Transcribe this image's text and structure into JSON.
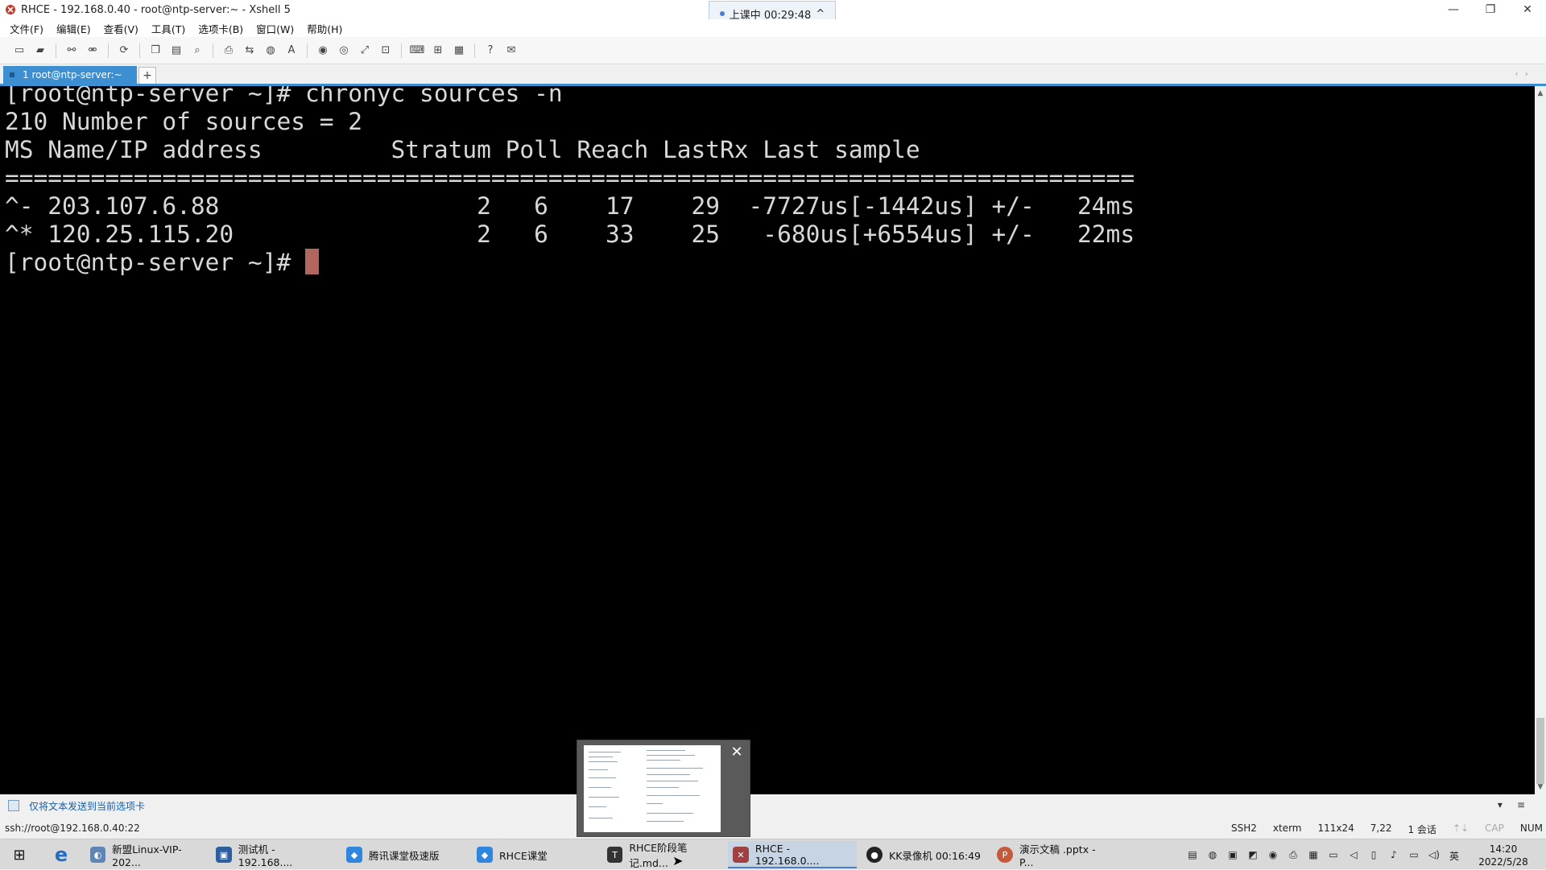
{
  "window": {
    "title": "RHCE - 192.168.0.40 - root@ntp-server:~ - Xshell 5",
    "controls": {
      "minimize": "—",
      "restore": "❐",
      "close": "✕"
    }
  },
  "session_indicator": {
    "label": "上课中 00:29:48",
    "chevron": "^"
  },
  "menu": [
    "文件(F)",
    "编辑(E)",
    "查看(V)",
    "工具(T)",
    "选项卡(B)",
    "窗口(W)",
    "帮助(H)"
  ],
  "toolbar": {
    "icons": [
      "new-session-icon",
      "open-folder-icon",
      "connect-icon",
      "disconnect-icon",
      "reconnect-icon",
      "copy-icon",
      "paste-icon",
      "find-icon",
      "print-icon",
      "transfer-icon",
      "globe-icon",
      "font-icon",
      "xftp-icon",
      "xmanager-icon",
      "fullscreen-icon",
      "lock-icon",
      "keyboard-icon",
      "add-pane-icon",
      "layout-icon",
      "help-icon",
      "chat-icon"
    ]
  },
  "tabs": [
    {
      "label": "1 root@ntp-server:~"
    }
  ],
  "tab_add_label": "+",
  "terminal": {
    "lines": [
      "[root@ntp-server ~]# chronyc sources -n",
      "210 Number of sources = 2",
      "MS Name/IP address         Stratum Poll Reach LastRx Last sample",
      "===============================================================================",
      "^- 203.107.6.88                  2   6    17    29  -7727us[-1442us] +/-   24ms",
      "^* 120.25.115.20                 2   6    33    25   -680us[+6554us] +/-   22ms",
      "[root@ntp-server ~]# "
    ],
    "background": "#000000",
    "foreground": "#d8d8d8",
    "cursor_color": "#b3665e"
  },
  "send_bar": {
    "label": "仅将文本发送到当前选项卡"
  },
  "status": {
    "connection": "ssh://root@192.168.0.40:22",
    "protocol": "SSH2",
    "terminal_type": "xterm",
    "size": "111x24",
    "cursor_pos": "7,22",
    "sessions": "1 会话",
    "caps": "CAP",
    "num": "NUM"
  },
  "taskbar": {
    "items": [
      {
        "label": "新盟Linux-VIP-202...",
        "icon": "app-icon"
      },
      {
        "label": "测试机 - 192.168....",
        "icon": "vm-icon"
      },
      {
        "label": "腾讯课堂极速版",
        "icon": "classroom-icon"
      },
      {
        "label": "RHCE课堂",
        "icon": "classroom-icon"
      },
      {
        "label": "RHCE阶段笔记.md...",
        "icon": "typora-icon"
      },
      {
        "label": "RHCE - 192.168.0....",
        "icon": "xshell-icon"
      },
      {
        "label": "KK录像机 00:16:49",
        "icon": "recorder-icon"
      },
      {
        "label": "演示文稿 .pptx - P...",
        "icon": "powerpoint-icon"
      }
    ],
    "tray_lang": "英",
    "time": "14:20",
    "date": "2022/5/28"
  }
}
